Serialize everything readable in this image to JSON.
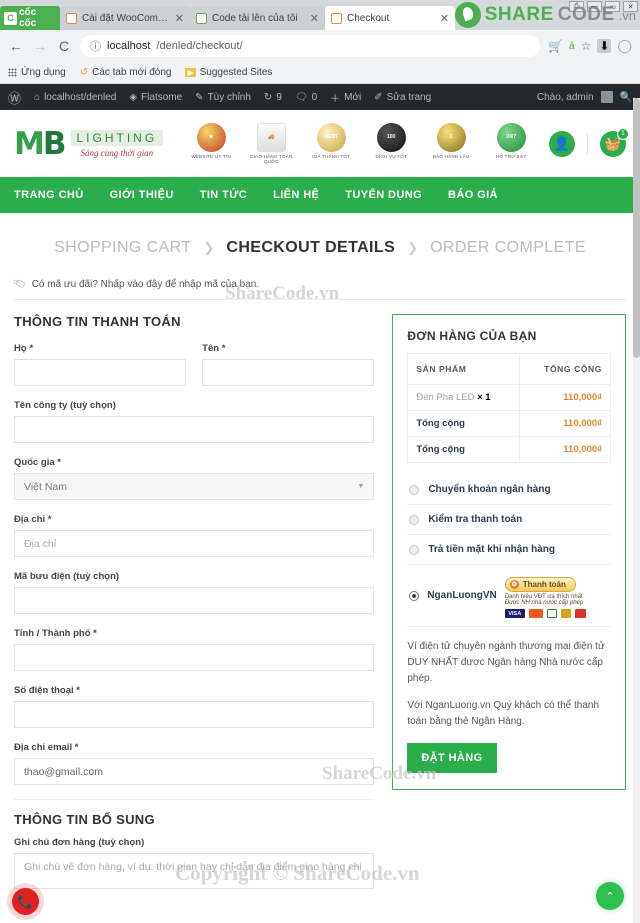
{
  "browser": {
    "brand_tab": "cốc cốc",
    "tabs": [
      {
        "title": "Cài đặt WooCommerce ‹ ...",
        "favicon": "woocommerce-icon",
        "active": false
      },
      {
        "title": "Code tải lên của tôi",
        "favicon": "sharecode-icon",
        "active": false
      },
      {
        "title": "Checkout",
        "favicon": "woocommerce-icon",
        "active": true
      }
    ],
    "new_tab_label": "+",
    "window_controls": [
      "restore-down",
      "minimize",
      "maximize",
      "close"
    ],
    "nav": {
      "back": "←",
      "forward": "→",
      "reload": "C"
    },
    "url": {
      "scheme_icon": "info-icon",
      "host": "localhost",
      "path": "/denled/checkout/"
    },
    "url_icons": [
      "cart-icon",
      "translate-icon",
      "bookmark-star-icon",
      "download-icon",
      "profile-icon"
    ],
    "bookmarks": [
      {
        "label": "Ứng dụng",
        "icon": "apps-grid-icon"
      },
      {
        "label": "Các tab mới đóng",
        "icon": "history-icon"
      },
      {
        "label": "Suggested Sites",
        "icon": "suggested-icon"
      }
    ]
  },
  "wpbar": {
    "logo": "wordpress-icon",
    "items": [
      {
        "label": "localhost/denled",
        "icon": "home-icon"
      },
      {
        "label": "Flatsome",
        "icon": "flatsome-icon"
      },
      {
        "label": "Tùy chỉnh",
        "icon": "pencil-icon"
      },
      {
        "label": "9",
        "icon": "updates-icon"
      },
      {
        "label": "0",
        "icon": "comment-icon"
      },
      {
        "label": "Mới",
        "icon": "plus-icon"
      },
      {
        "label": "Sửa trang",
        "icon": "edit-icon"
      }
    ],
    "greeting": "Chào, admin",
    "search_icon": "search-icon"
  },
  "site": {
    "logo": {
      "mark_m": "M",
      "mark_b": "B",
      "word": "LIGHTING",
      "slogan": "Sáng cùng thời gian"
    },
    "badges": [
      {
        "caption": "WEBSITE UY TÍN",
        "icon": "ribbon-medal-icon"
      },
      {
        "caption": "GIAO HÀNG TOÀN QUỐC",
        "icon": "truck-icon"
      },
      {
        "caption": "GIÁ THÀNH TỐT",
        "icon": "best-price-icon"
      },
      {
        "caption": "DỊCH VỤ TỐT",
        "icon": "service-medal-icon"
      },
      {
        "caption": "BẢO HÀNH LÂU",
        "icon": "warranty-medal-icon"
      },
      {
        "caption": "HỖ TRỢ 24/7",
        "icon": "support-icon"
      }
    ],
    "account_icon": "user-icon",
    "cart_icon": "basket-icon",
    "cart_count": "1",
    "nav": [
      "TRANG CHỦ",
      "GIỚI THIỆU",
      "TIN TỨC",
      "LIÊN HỆ",
      "TUYỂN DỤNG",
      "BÁO GIÁ"
    ]
  },
  "checkout": {
    "steps": [
      {
        "label": "SHOPPING CART",
        "current": false
      },
      {
        "label": "CHECKOUT DETAILS",
        "current": true
      },
      {
        "label": "ORDER COMPLETE",
        "current": false
      }
    ],
    "step_separator": "❯",
    "coupon_notice": "Có mã ưu đãi? Nhấp vào đây để nhập mã của bạn.",
    "billing": {
      "title": "THÔNG TIN THANH TOÁN",
      "fields": {
        "last_name": {
          "label": "Họ",
          "required": "*",
          "value": "",
          "placeholder": ""
        },
        "first_name": {
          "label": "Tên",
          "required": "*",
          "value": "",
          "placeholder": ""
        },
        "company": {
          "label": "Tên công ty (tuỳ chọn)",
          "required": "",
          "value": "",
          "placeholder": ""
        },
        "country": {
          "label": "Quốc gia",
          "required": "*",
          "value": "Việt Nam"
        },
        "address": {
          "label": "Địa chỉ",
          "required": "*",
          "value": "",
          "placeholder": "Địa chỉ"
        },
        "postcode": {
          "label": "Mã bưu điện (tuỳ chọn)",
          "required": "",
          "value": "",
          "placeholder": ""
        },
        "city": {
          "label": "Tỉnh / Thành phố",
          "required": "*",
          "value": "",
          "placeholder": ""
        },
        "phone": {
          "label": "Số điện thoại",
          "required": "*",
          "value": "",
          "placeholder": ""
        },
        "email": {
          "label": "Địa chỉ email",
          "required": "*",
          "value": "thao@gmail.com",
          "placeholder": ""
        }
      }
    },
    "additional": {
      "title": "THÔNG TIN BỔ SUNG",
      "note_label": "Ghi chú đơn hàng (tuỳ chọn)",
      "note_placeholder": "Ghi chú về đơn hàng, ví dụ: thời gian hay chỉ dẫn địa điểm giao hàng chi",
      "note_value": ""
    },
    "order": {
      "title": "ĐƠN HÀNG CỦA BẠN",
      "columns": [
        "SẢN PHẨM",
        "TỔNG CỘNG"
      ],
      "rows": [
        {
          "name": "Đèn Pha LED",
          "qty": "× 1",
          "amount": "110,000₫",
          "bold": false
        },
        {
          "name": "Tổng cộng",
          "qty": "",
          "amount": "110,000₫",
          "bold": true
        },
        {
          "name": "Tổng cộng",
          "qty": "",
          "amount": "110,000₫",
          "bold": true
        }
      ],
      "payment_methods": [
        {
          "label": "Chuyển khoản ngân hàng",
          "selected": false
        },
        {
          "label": "Kiểm tra thanh toán",
          "selected": false
        },
        {
          "label": "Trả tiền mặt khi nhận hàng",
          "selected": false
        },
        {
          "label": "NganLuongVN",
          "selected": true
        }
      ],
      "nganluong": {
        "button_label": "Thanh toán",
        "line1": "Danh hiệu VĐT ưa thích nhất",
        "line2": "Được NH nhà nước cấp phép",
        "cards": [
          "VISA",
          "MC",
          "V",
          "O",
          "R"
        ]
      },
      "description_1": "Ví điện tử chuyên ngành thương mại điện tử DUY NHẤT được Ngân hàng Nhà nước cấp phép.",
      "description_2": "Với NganLuong.vn Quý khách có thể thanh toán bằng thẻ Ngân Hàng.",
      "place_order": "ĐẶT HÀNG"
    }
  },
  "watermarks": {
    "w1": "ShareCode.vn",
    "w2": "ShareCode.vn",
    "w3": "Copyright © ShareCode.vn",
    "logo": {
      "a": "SHARE",
      "b": "CODE",
      "c": ".vn"
    }
  },
  "floating": {
    "phone_icon": "phone-icon",
    "back_to_top_icon": "chevron-up-icon"
  }
}
